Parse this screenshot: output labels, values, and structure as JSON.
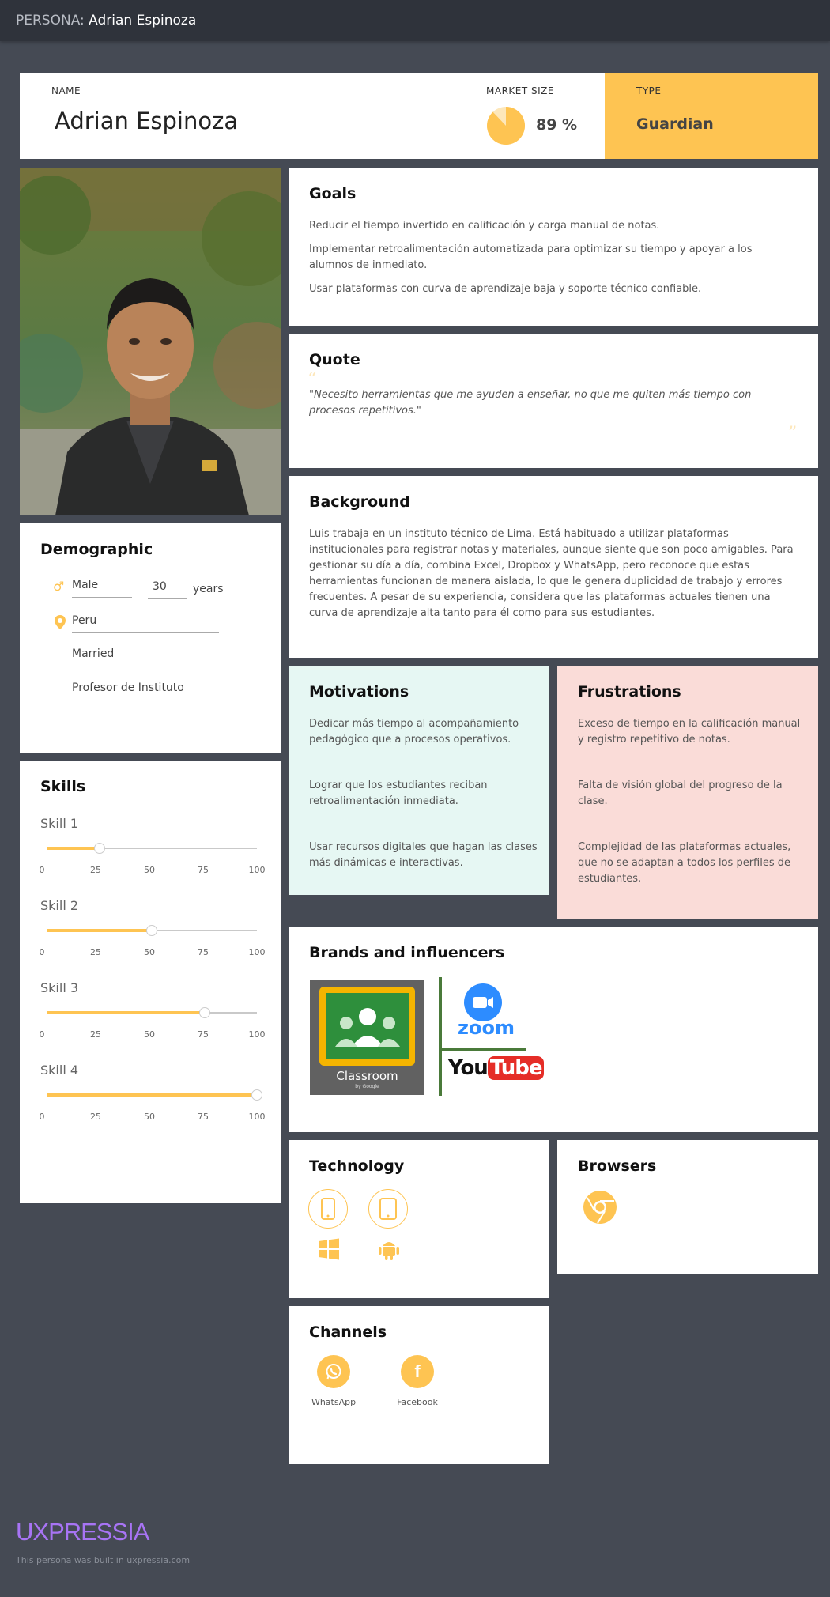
{
  "header": {
    "prefix": "PERSONA:",
    "name": "Adrian Espinoza"
  },
  "summary": {
    "name_label": "NAME",
    "name": "Adrian Espinoza",
    "market_label": "MARKET SIZE",
    "market_value": "89 %",
    "market_fraction": 0.89,
    "type_label": "TYPE",
    "type": "Guardian"
  },
  "goals": {
    "title": "Goals",
    "items": [
      "Reducir el tiempo invertido en calificación y carga manual de notas.",
      "Implementar retroalimentación automatizada para optimizar su tiempo y apoyar a los alumnos de inmediato.",
      "Usar plataformas con curva de aprendizaje baja y soporte técnico confiable."
    ]
  },
  "quote": {
    "title": "Quote",
    "text": "\"Necesito herramientas que me ayuden a enseñar, no que me quiten más tiempo con procesos repetitivos.\""
  },
  "background": {
    "title": "Background",
    "text": "Luis trabaja en un instituto técnico de Lima. Está habituado a utilizar plataformas institucionales para registrar notas y materiales, aunque siente que son poco amigables. Para gestionar su día a día, combina Excel, Dropbox y WhatsApp, pero reconoce que estas herramientas funcionan de manera aislada, lo que le genera duplicidad de trabajo y errores frecuentes. A pesar de su experiencia, considera que las plataformas actuales tienen una curva de aprendizaje alta tanto para él como para sus estudiantes."
  },
  "demographic": {
    "title": "Demographic",
    "gender": "Male",
    "age": "30",
    "age_unit": "years",
    "location": "Peru",
    "status": "Married",
    "occupation": "Profesor de Instituto"
  },
  "skills": {
    "title": "Skills",
    "scale": [
      "0",
      "25",
      "50",
      "75",
      "100"
    ],
    "items": [
      {
        "name": "Skill 1",
        "value": 25
      },
      {
        "name": "Skill 2",
        "value": 50
      },
      {
        "name": "Skill 3",
        "value": 75
      },
      {
        "name": "Skill 4",
        "value": 100
      }
    ]
  },
  "motivations": {
    "title": "Motivations",
    "items": [
      "Dedicar más tiempo al acompañamiento pedagógico que a procesos operativos.",
      "Lograr que los estudiantes reciban retroalimentación inmediata.",
      "Usar recursos digitales que hagan las clases más dinámicas e interactivas."
    ]
  },
  "frustrations": {
    "title": "Frustrations",
    "items": [
      "Exceso de tiempo en la calificación manual y registro repetitivo de notas.",
      "Falta de visión global del progreso de la clase.",
      "Complejidad de las plataformas actuales, que no se adaptan a todos los perfiles de estudiantes."
    ]
  },
  "brands": {
    "title": "Brands and influencers",
    "classroom": "Classroom",
    "classroom_sub": "by Google",
    "zoom": "zoom",
    "youtube_a": "You",
    "youtube_b": "Tube"
  },
  "technology": {
    "title": "Technology",
    "icons": [
      "smartphone-icon",
      "tablet-icon",
      "windows-icon",
      "android-icon"
    ]
  },
  "browsers": {
    "title": "Browsers",
    "icons": [
      "chrome-icon"
    ]
  },
  "channels": {
    "title": "Channels",
    "items": [
      "WhatsApp",
      "Facebook"
    ]
  },
  "footer": {
    "brand": "UXPRESSIA",
    "note": "This persona was built in uxpressia.com"
  },
  "colors": {
    "accent": "#fec452",
    "motivations_bg": "#e6f7f3",
    "frustrations_bg": "#fadcd8",
    "brand": "#a874f5"
  }
}
